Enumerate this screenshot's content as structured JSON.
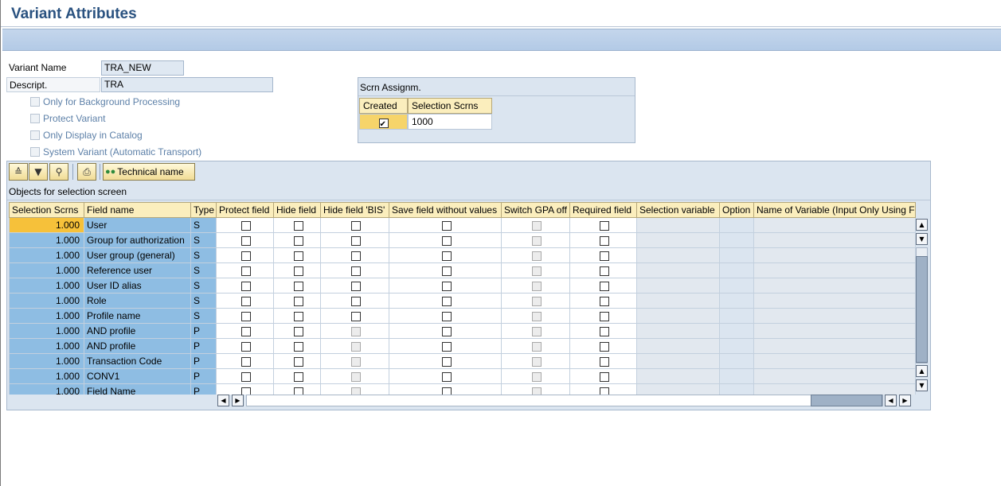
{
  "header": {
    "title": "Variant Attributes"
  },
  "form": {
    "variant_name_label": "Variant Name",
    "variant_name_value": "TRA_NEW",
    "descript_label": "Descript.",
    "descript_value": "TRA",
    "options": [
      {
        "label": "Only for Background Processing",
        "checked": false
      },
      {
        "label": "Protect Variant",
        "checked": false
      },
      {
        "label": "Only Display in Catalog",
        "checked": false
      },
      {
        "label": "System Variant (Automatic Transport)",
        "checked": false
      }
    ]
  },
  "scrn_assign": {
    "title": "Scrn Assignm.",
    "col_created": "Created",
    "col_selection": "Selection Scrns",
    "row": {
      "created": true,
      "selection": "1000"
    }
  },
  "toolbar": {
    "icons": [
      "detail-icon",
      "filter-icon",
      "find-icon",
      "print-icon"
    ],
    "technical_name_label": "Technical name"
  },
  "table": {
    "title": "Objects for selection screen",
    "columns": [
      "Selection Scrns",
      "Field name",
      "Type",
      "Protect field",
      "Hide field",
      "Hide field 'BIS'",
      "Save field without values",
      "Switch GPA off",
      "Required field",
      "Selection variable",
      "Option",
      "Name of Variable (Input Only Using F"
    ],
    "rows": [
      {
        "scrn": "1.000",
        "field": "User",
        "type": "S",
        "bis_disabled": false
      },
      {
        "scrn": "1.000",
        "field": "Group for authorization",
        "type": "S",
        "bis_disabled": false
      },
      {
        "scrn": "1.000",
        "field": "User group (general)",
        "type": "S",
        "bis_disabled": false
      },
      {
        "scrn": "1.000",
        "field": "Reference user",
        "type": "S",
        "bis_disabled": false
      },
      {
        "scrn": "1.000",
        "field": "User ID alias",
        "type": "S",
        "bis_disabled": false
      },
      {
        "scrn": "1.000",
        "field": "Role",
        "type": "S",
        "bis_disabled": false
      },
      {
        "scrn": "1.000",
        "field": "Profile name",
        "type": "S",
        "bis_disabled": false
      },
      {
        "scrn": "1.000",
        "field": "AND profile",
        "type": "P",
        "bis_disabled": true
      },
      {
        "scrn": "1.000",
        "field": "AND profile",
        "type": "P",
        "bis_disabled": true
      },
      {
        "scrn": "1.000",
        "field": "Transaction Code",
        "type": "P",
        "bis_disabled": true
      },
      {
        "scrn": "1.000",
        "field": "CONV1",
        "type": "P",
        "bis_disabled": true
      },
      {
        "scrn": "1.000",
        "field": "Field Name",
        "type": "P",
        "bis_disabled": true
      }
    ]
  },
  "colors": {
    "title": "#2a5280",
    "header_cell": "#fbeebd",
    "key_cell": "#8ebde3",
    "selected_cell": "#f6c13a",
    "panel": "#dbe5f0"
  }
}
